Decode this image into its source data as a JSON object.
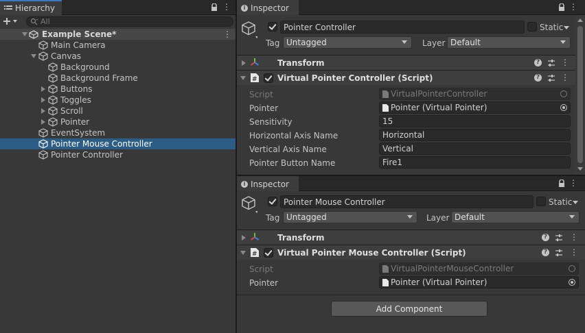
{
  "hierarchy": {
    "tab_label": "Hierarchy",
    "search_placeholder": "All",
    "scene_name": "Example Scene*",
    "items": [
      {
        "label": "Main Camera"
      },
      {
        "label": "Canvas"
      },
      {
        "label": "Background"
      },
      {
        "label": "Background Frame"
      },
      {
        "label": "Buttons"
      },
      {
        "label": "Toggles"
      },
      {
        "label": "Scroll"
      },
      {
        "label": "Pointer"
      },
      {
        "label": "EventSystem"
      },
      {
        "label": "Pointer Mouse Controller"
      },
      {
        "label": "Pointer Controller"
      }
    ],
    "selected_item": "Pointer Mouse Controller"
  },
  "inspector1": {
    "tab_label": "Inspector",
    "object_name": "Pointer Controller",
    "static_label": "Static",
    "tag_label": "Tag",
    "tag_value": "Untagged",
    "layer_label": "Layer",
    "layer_value": "Default",
    "transform_label": "Transform",
    "script_component_label": "Virtual Pointer Controller (Script)",
    "fields": {
      "script_label": "Script",
      "script_value": "VirtualPointerController",
      "pointer_label": "Pointer",
      "pointer_value": "Pointer (Virtual Pointer)",
      "sensitivity_label": "Sensitivity",
      "sensitivity_value": "15",
      "horizontal_label": "Horizontal Axis Name",
      "horizontal_value": "Horizontal",
      "vertical_label": "Vertical Axis Name",
      "vertical_value": "Vertical",
      "button_label": "Pointer Button Name",
      "button_value": "Fire1"
    }
  },
  "inspector2": {
    "tab_label": "Inspector",
    "object_name": "Pointer Mouse Controller",
    "static_label": "Static",
    "tag_label": "Tag",
    "tag_value": "Untagged",
    "layer_label": "Layer",
    "layer_value": "Default",
    "transform_label": "Transform",
    "script_component_label": "Virtual Pointer Mouse Controller (Script)",
    "fields": {
      "script_label": "Script",
      "script_value": "VirtualPointerMouseController",
      "pointer_label": "Pointer",
      "pointer_value": "Pointer (Virtual Pointer)"
    },
    "add_component_label": "Add Component"
  },
  "colors": {
    "selection": "#2c5d87",
    "accent_tab": "#3a78c3",
    "panel_bg": "#383838",
    "header_bg": "#3e3e3e"
  }
}
